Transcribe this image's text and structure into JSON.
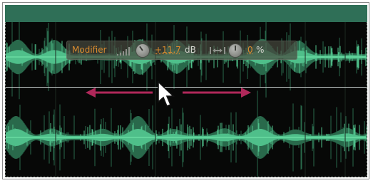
{
  "hud": {
    "label": "Modifier",
    "gain_value": "+11,7",
    "gain_unit": "dB",
    "pan_value": "0",
    "pan_unit": "%",
    "icons": [
      "level-meter-icon",
      "gain-knob-icon",
      "pan-icon",
      "pan-knob-icon"
    ]
  },
  "colors": {
    "title_bar": "#2f6f57",
    "waveform": "#4fbf8a",
    "waveform_dim": "#2f7a58",
    "background": "#070807",
    "hud_text": "#d98b2f",
    "arrow": "#b0285a"
  },
  "annotations": [
    "drag-left-arrow",
    "drag-right-arrow",
    "mouse-pointer-icon"
  ]
}
